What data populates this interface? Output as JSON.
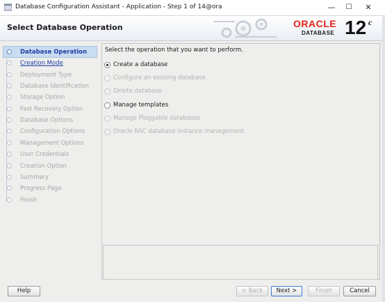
{
  "window": {
    "title": "Database Configuration Assistant - Application - Step 1 of 14@ora",
    "controls": {
      "minimize": "—",
      "maximize": "☐",
      "close": "✕"
    }
  },
  "header": {
    "title": "Select Database Operation",
    "brand": {
      "oracle": "ORACLE",
      "database": "DATABASE",
      "version": "12",
      "version_sup": "c"
    }
  },
  "nav": {
    "items": [
      {
        "label": "Database Operation",
        "state": "active"
      },
      {
        "label": "Creation Mode",
        "state": "link"
      },
      {
        "label": "Deployment Type",
        "state": "disabled"
      },
      {
        "label": "Database Identification",
        "state": "disabled"
      },
      {
        "label": "Storage Option",
        "state": "disabled"
      },
      {
        "label": "Fast Recovery Option",
        "state": "disabled"
      },
      {
        "label": "Database Options",
        "state": "disabled"
      },
      {
        "label": "Configuration Options",
        "state": "disabled"
      },
      {
        "label": "Management Options",
        "state": "disabled"
      },
      {
        "label": "User Credentials",
        "state": "disabled"
      },
      {
        "label": "Creation Option",
        "state": "disabled"
      },
      {
        "label": "Summary",
        "state": "disabled"
      },
      {
        "label": "Progress Page",
        "state": "disabled"
      },
      {
        "label": "Finish",
        "state": "disabled"
      }
    ]
  },
  "main": {
    "prompt": "Select the operation that you want to perform.",
    "options": [
      {
        "label": "Create a database",
        "selected": true,
        "enabled": true
      },
      {
        "label": "Configure an existing database",
        "selected": false,
        "enabled": false
      },
      {
        "label": "Delete database",
        "selected": false,
        "enabled": false
      },
      {
        "label": "Manage templates",
        "selected": false,
        "enabled": true
      },
      {
        "label": "Manage Pluggable databases",
        "selected": false,
        "enabled": false
      },
      {
        "label": "Oracle RAC database instance management",
        "selected": false,
        "enabled": false
      }
    ]
  },
  "buttons": {
    "help": "Help",
    "back": "< Back",
    "next": "Next >",
    "finish": "Finish",
    "cancel": "Cancel"
  },
  "colors": {
    "oracle_red": "#e3231a",
    "nav_active_bg": "#c9dcf1",
    "link": "#1f3fa6"
  }
}
